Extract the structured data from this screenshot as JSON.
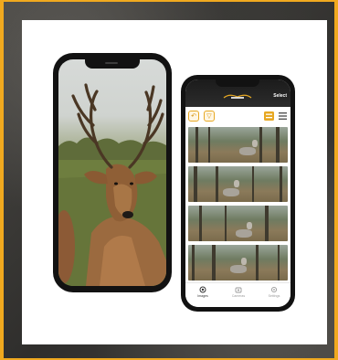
{
  "app": {
    "header_select_label": "Select",
    "tabs": [
      {
        "label": "Images",
        "icon": "camera-icon",
        "active": true
      },
      {
        "label": "Cameras",
        "icon": "trail-camera-icon",
        "active": false
      },
      {
        "label": "Settings",
        "icon": "gear-icon",
        "active": false
      }
    ]
  },
  "colors": {
    "accent": "#f0a91f",
    "toolbar_accent": "#e7a823",
    "phone_body": "#121212",
    "header_bg": "#1b1b1b"
  },
  "icons": {
    "undo": "undo-arrow-icon",
    "filter": "filter-icon",
    "list_view": "list-view-icon",
    "grid_view": "grid-view-icon",
    "logo": "antler-logo-icon"
  }
}
